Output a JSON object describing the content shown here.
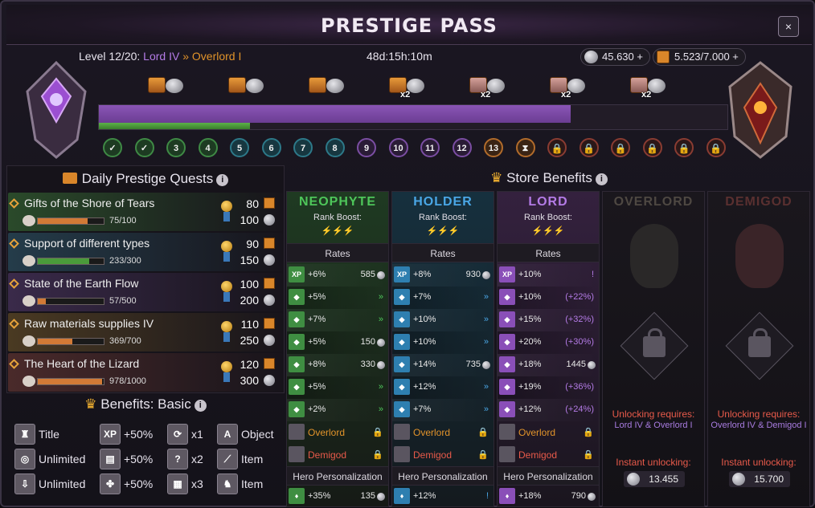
{
  "header": {
    "title": "PRESTIGE PASS",
    "level_text": "Level 12/20: ",
    "current_rank": "Lord IV",
    "sep": "»",
    "next_rank": "Overlord I",
    "timer": "48d:15h:10m",
    "silver": "45.630 +",
    "crates": "5.523/7.000 +",
    "close": "×"
  },
  "progress": {
    "purple_fill": 0.75,
    "green_fill": 0.24,
    "rewards": [
      {
        "mult": ""
      },
      {
        "mult": ""
      },
      {
        "mult": ""
      },
      {
        "mult": "x2"
      },
      {
        "mult": "x2"
      },
      {
        "mult": "x2"
      },
      {
        "mult": "x2"
      }
    ],
    "nodes": [
      "✓",
      "✓",
      "3",
      "4",
      "5",
      "6",
      "7",
      "8",
      "9",
      "10",
      "11",
      "12",
      "13",
      "⧗",
      "🔒",
      "🔒",
      "🔒",
      "🔒",
      "🔒",
      "🔒"
    ]
  },
  "quests": {
    "title": "Daily Prestige Quests",
    "items": [
      {
        "name": "Gifts of the Shore of Tears",
        "progress": "75/100",
        "fill": 0.75,
        "v1": "80",
        "v2": "100"
      },
      {
        "name": "Support of different types",
        "progress": "233/300",
        "fill": 0.78,
        "v1": "90",
        "v2": "150"
      },
      {
        "name": "State of the Earth Flow",
        "progress": "57/500",
        "fill": 0.12,
        "v1": "100",
        "v2": "200"
      },
      {
        "name": "Raw materials supplies IV",
        "progress": "369/700",
        "fill": 0.53,
        "v1": "110",
        "v2": "250"
      },
      {
        "name": "The Heart of the Lizard",
        "progress": "978/1000",
        "fill": 0.98,
        "v1": "120",
        "v2": "300"
      }
    ]
  },
  "benefits": {
    "title": "Benefits: Basic",
    "items": [
      {
        "icon": "title-icon",
        "label": "Title"
      },
      {
        "icon": "xp-icon",
        "label": "+50%"
      },
      {
        "icon": "refresh-icon",
        "label": "x1"
      },
      {
        "icon": "object-icon",
        "label": "Object"
      },
      {
        "icon": "unlimited-icon",
        "label": "Unlimited"
      },
      {
        "icon": "book-icon",
        "label": "+50%"
      },
      {
        "icon": "question-icon",
        "label": "x2"
      },
      {
        "icon": "item-icon",
        "label": "Item"
      },
      {
        "icon": "download-icon",
        "label": "Unlimited"
      },
      {
        "icon": "clover-icon",
        "label": "+50%"
      },
      {
        "icon": "multi-icon",
        "label": "x3"
      },
      {
        "icon": "horse-icon",
        "label": "Item"
      }
    ]
  },
  "store": {
    "title": "Store Benefits",
    "rank_boost": "Rank Boost:",
    "rates": "Rates",
    "hero": "Hero Personalization",
    "columns": [
      {
        "name": "NEOPHYTE",
        "color": "#4ec65a",
        "rows": [
          {
            "icon": "XP",
            "v": "+6%",
            "r": "585"
          },
          {
            "icon": "",
            "v": "+5%",
            "r": "»"
          },
          {
            "icon": "",
            "v": "+7%",
            "r": "»"
          },
          {
            "icon": "",
            "v": "+5%",
            "r": "150"
          },
          {
            "icon": "",
            "v": "+8%",
            "r": "330"
          },
          {
            "icon": "",
            "v": "+5%",
            "r": "»"
          },
          {
            "icon": "",
            "v": "+2%",
            "r": "»"
          }
        ],
        "overlord": "Overlord",
        "demigod": "Demigod",
        "hero_v": "+35%",
        "hero_r": "135"
      },
      {
        "name": "HOLDER",
        "color": "#4aa7e6",
        "rows": [
          {
            "icon": "XP",
            "v": "+8%",
            "r": "930"
          },
          {
            "icon": "",
            "v": "+7%",
            "r": "»"
          },
          {
            "icon": "",
            "v": "+10%",
            "r": "»"
          },
          {
            "icon": "",
            "v": "+10%",
            "r": "»"
          },
          {
            "icon": "",
            "v": "+14%",
            "r": "735"
          },
          {
            "icon": "",
            "v": "+12%",
            "r": "»"
          },
          {
            "icon": "",
            "v": "+7%",
            "r": "»"
          }
        ],
        "overlord": "Overlord",
        "demigod": "Demigod",
        "hero_v": "+12%",
        "hero_r": "!"
      },
      {
        "name": "LORD",
        "color": "#b47be6",
        "rows": [
          {
            "icon": "XP",
            "v": "+10%",
            "r": "!"
          },
          {
            "icon": "",
            "v": "+10%",
            "r": "(+22%)"
          },
          {
            "icon": "",
            "v": "+15%",
            "r": "(+32%)"
          },
          {
            "icon": "",
            "v": "+20%",
            "r": "(+30%)"
          },
          {
            "icon": "",
            "v": "+18%",
            "r": "1445"
          },
          {
            "icon": "",
            "v": "+19%",
            "r": "(+36%)"
          },
          {
            "icon": "",
            "v": "+12%",
            "r": "(+24%)"
          }
        ],
        "overlord": "Overlord",
        "demigod": "Demigod",
        "hero_v": "+18%",
        "hero_r": "790"
      }
    ],
    "locked": [
      {
        "name": "OVERLORD",
        "req": "Unlocking requires:",
        "req2": "Lord IV & Overlord I",
        "instant": "Instant unlocking:",
        "price": "13.455"
      },
      {
        "name": "DEMIGOD",
        "req": "Unlocking requires:",
        "req2": "Overlord IV & Demigod I",
        "instant": "Instant unlocking:",
        "price": "15.700"
      }
    ]
  }
}
